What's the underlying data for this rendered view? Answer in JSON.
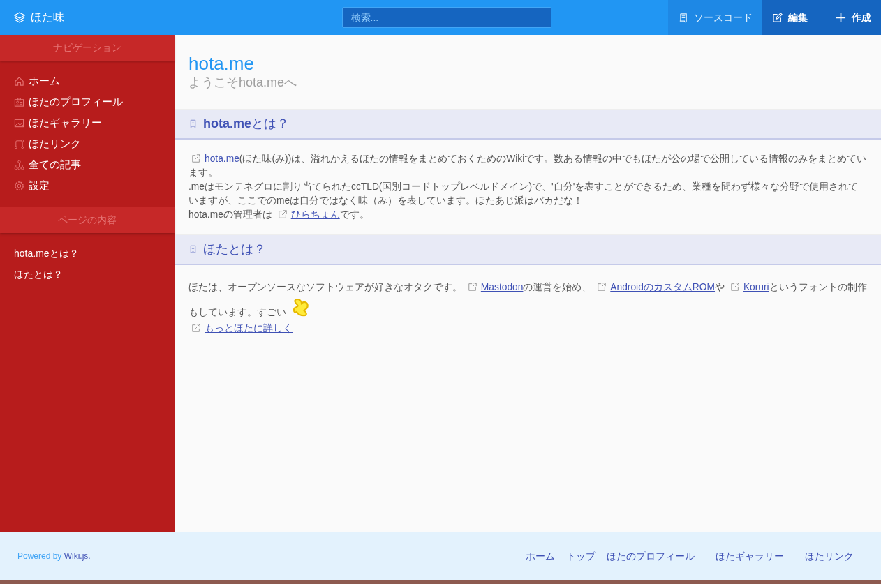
{
  "header": {
    "brand": "ほた味",
    "search": {
      "placeholder": "検索..."
    },
    "actions": [
      {
        "kind": "source",
        "label": "ソースコード"
      },
      {
        "kind": "edit",
        "label": "編集"
      },
      {
        "kind": "create",
        "label": "作成"
      }
    ]
  },
  "sidebar": {
    "sections": [
      {
        "title": "ナビゲーション",
        "items": [
          {
            "kind": "home",
            "label": "ホーム"
          },
          {
            "kind": "profile",
            "label": "ほたのプロフィール"
          },
          {
            "kind": "image",
            "label": "ほたギャラリー"
          },
          {
            "kind": "link",
            "label": "ほたリンク"
          },
          {
            "kind": "tree",
            "label": "全ての記事"
          },
          {
            "kind": "gear",
            "label": "設定"
          }
        ]
      },
      {
        "title": "ページの内容",
        "items": [
          {
            "label": "hota.meとは？"
          },
          {
            "label": "ほたとは？"
          }
        ]
      }
    ]
  },
  "page": {
    "title": "hota.me",
    "subtitle": "ようこそhota.meへ",
    "sections": [
      {
        "heading": "**hota.me**とは？",
        "paragraphs": [
          [
            [
              {
                "kind": "link",
                "text": "hota.me"
              },
              {
                "kind": "text",
                "text": "(ほた味(み))は、溢れかえるほたの情報をまとめておくためのWikiです。数ある情報の中でもほたが公の場で公開している情報のみをまとめています。"
              }
            ],
            [
              {
                "kind": "text",
                "text": ".meはモンテネグロに割り当てられたccTLD(国別コードトップレベルドメイン)で、'自分'を表すことができるため、業種を問わず様々な分野で使用されていますが、ここでのmeは自分ではなく味（み）を表しています。ほたあじ派はバカだな！"
              }
            ],
            [
              {
                "kind": "text",
                "text": "hota.meの管理者は "
              },
              {
                "kind": "link",
                "text": "ひらちょん"
              },
              {
                "kind": "text",
                "text": "です。"
              }
            ]
          ]
        ]
      },
      {
        "heading": "ほたとは？",
        "paragraphs": [
          [
            [
              {
                "kind": "text",
                "text": "ほたは、オープンソースなソフトウェアが好きなオタクです。 "
              },
              {
                "kind": "link",
                "text": "Mastodon"
              },
              {
                "kind": "text",
                "text": "の運営を始め、 "
              },
              {
                "kind": "link",
                "text": "AndroidのカスタムROM"
              },
              {
                "kind": "text",
                "text": "や "
              },
              {
                "kind": "link",
                "text": "Koruri"
              },
              {
                "kind": "text",
                "text": "というフォントの制作もしています。すごい"
              },
              {
                "kind": "sticker"
              }
            ],
            [
              {
                "kind": "link",
                "text": "もっとほたに詳しく"
              }
            ]
          ]
        ]
      }
    ]
  },
  "footer": {
    "powered": "Powered by ",
    "brand": "Wiki.js.",
    "links": [
      "ホーム",
      "トップ",
      "ほたのプロフィール",
      "ほたギャラリー",
      "ほたリンク"
    ]
  }
}
